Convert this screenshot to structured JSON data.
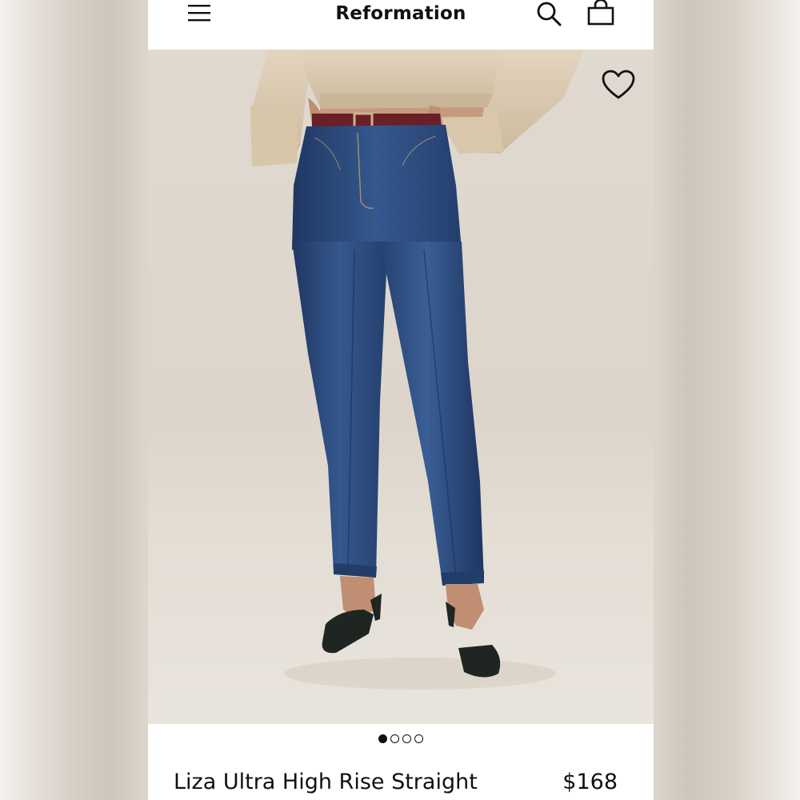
{
  "header": {
    "brand": "Reformation",
    "menu_icon": "hamburger-menu-icon",
    "search_icon": "search-icon",
    "bag_icon": "shopping-bag-icon"
  },
  "product": {
    "image_description_icon": "heart-icon",
    "carousel": {
      "total": 4,
      "active": 1
    },
    "name": "Liza Ultra High Rise Straight",
    "price": "$168"
  },
  "colors": {
    "accent": "#111111",
    "denim": "#2d4a7a",
    "sweater": "#d9c8b0",
    "belt": "#6b1f27",
    "background": "#e0d9d0"
  }
}
